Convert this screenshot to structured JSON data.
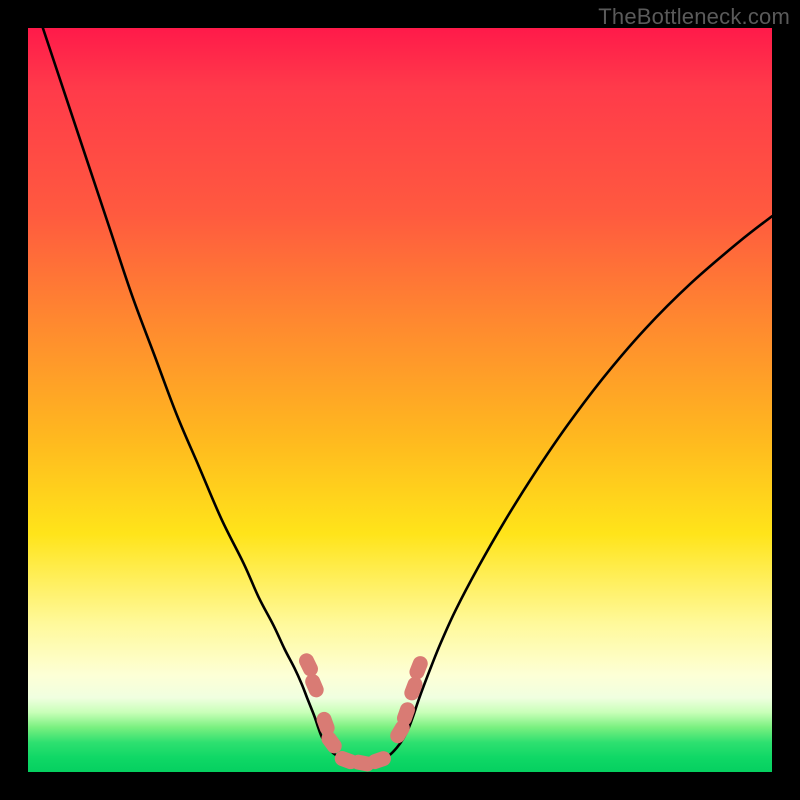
{
  "watermark": {
    "text": "TheBottleneck.com"
  },
  "colors": {
    "curve": "#000000",
    "marker_fill": "#d97b74",
    "marker_stroke": "#c96a63"
  },
  "chart_data": {
    "type": "line",
    "title": "",
    "xlabel": "",
    "ylabel": "",
    "xlim": [
      0,
      100
    ],
    "ylim": [
      0,
      100
    ],
    "grid": false,
    "legend": false,
    "note": "Values are normalized percentages of the plot area (0–100). Y runs top→bottom as drawn (higher y = lower on screen, closer to green = better match). Two separate curve segments form a V.",
    "series": [
      {
        "name": "left-branch",
        "x": [
          2,
          5,
          8,
          11,
          14,
          17,
          20,
          23,
          26,
          29,
          31,
          33,
          34.5,
          35.8,
          36.8,
          37.5,
          38.1,
          38.6,
          39.0,
          39.5,
          40.2,
          41.2,
          43.0,
          45.0
        ],
        "y": [
          0,
          9,
          18,
          27,
          36,
          44,
          52,
          59,
          66,
          72,
          76.5,
          80.3,
          83.5,
          86.0,
          88.2,
          90.0,
          91.5,
          92.8,
          94.0,
          95.3,
          96.5,
          97.6,
          98.6,
          99.0
        ]
      },
      {
        "name": "right-branch",
        "x": [
          45.0,
          47.0,
          48.5,
          49.6,
          50.5,
          51.2,
          51.8,
          52.4,
          53.2,
          54.2,
          55.5,
          57.5,
          60.5,
          64.0,
          68.0,
          72.5,
          77.5,
          83.0,
          89.0,
          95.5,
          100.0
        ],
        "y": [
          99.0,
          98.6,
          97.8,
          96.7,
          95.4,
          94.0,
          92.4,
          90.6,
          88.4,
          85.8,
          82.6,
          78.2,
          72.5,
          66.4,
          60.0,
          53.4,
          46.8,
          40.4,
          34.4,
          28.8,
          25.3
        ]
      }
    ],
    "markers": {
      "name": "highlighted-points",
      "shape": "rounded-capsule",
      "points_xy": [
        [
          37.7,
          85.6
        ],
        [
          38.5,
          88.4
        ],
        [
          40.0,
          93.5
        ],
        [
          40.8,
          96.0
        ],
        [
          42.8,
          98.4
        ],
        [
          45.0,
          98.8
        ],
        [
          47.2,
          98.4
        ],
        [
          50.0,
          94.6
        ],
        [
          50.8,
          92.2
        ],
        [
          51.8,
          88.8
        ],
        [
          52.5,
          86.0
        ]
      ]
    }
  }
}
